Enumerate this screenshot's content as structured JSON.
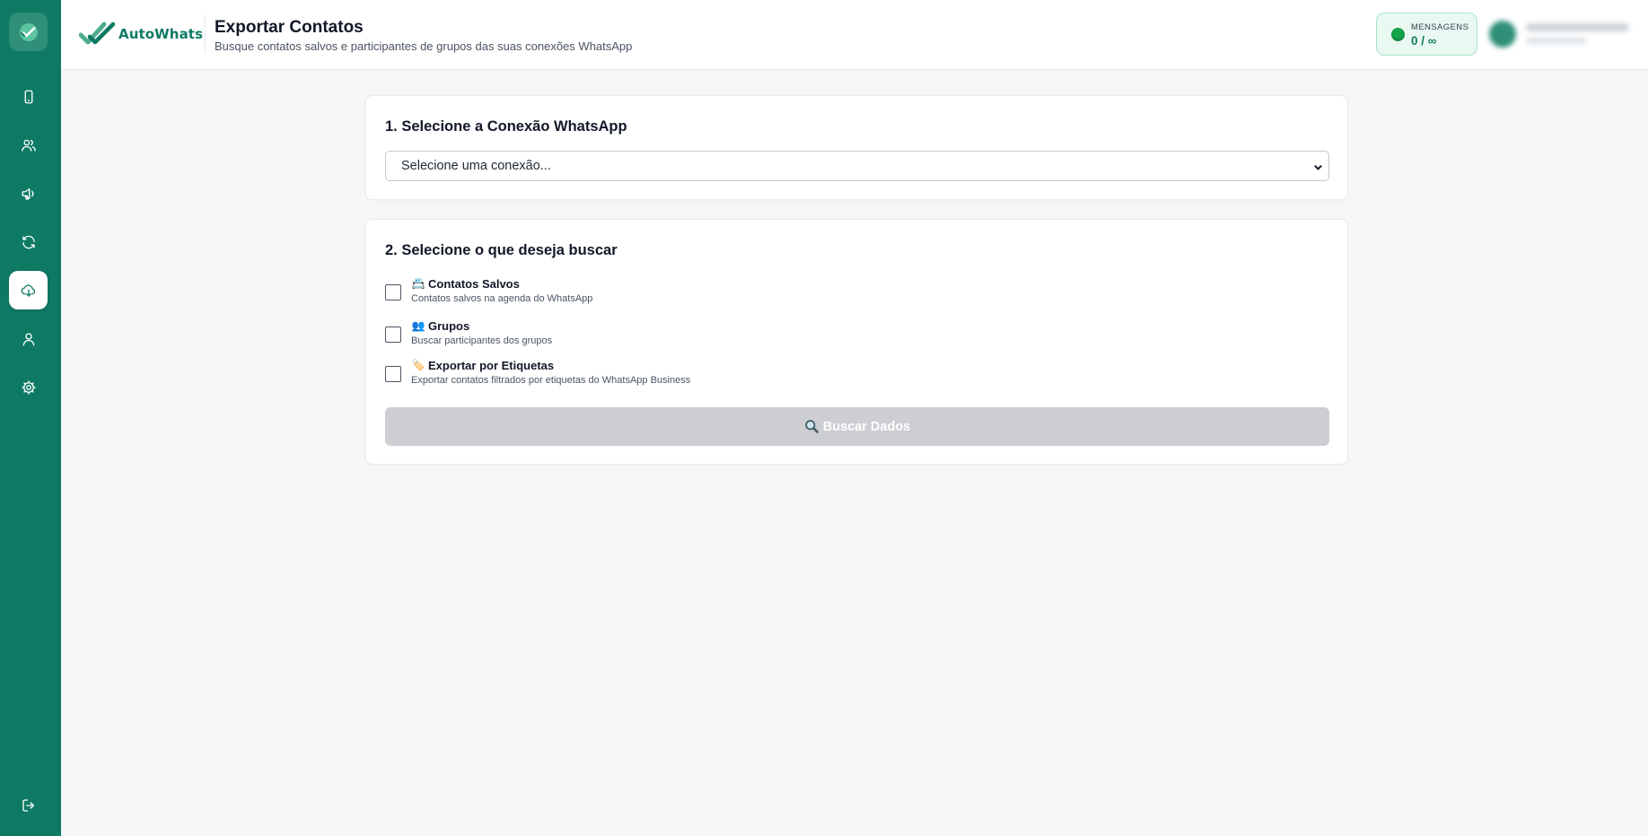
{
  "app": {
    "name": "AutoWhats"
  },
  "header": {
    "title": "Exportar Contatos",
    "subtitle": "Busque contatos salvos e participantes de grupos das suas conexões WhatsApp"
  },
  "messages_badge": {
    "label": "MENSAGENS",
    "count": "0 / ∞",
    "status_color": "#16a34a"
  },
  "sidebar": {
    "items": [
      {
        "name": "connections",
        "icon": "smartphone-icon"
      },
      {
        "name": "contacts",
        "icon": "users-icon"
      },
      {
        "name": "campaigns",
        "icon": "megaphone-icon"
      },
      {
        "name": "sync",
        "icon": "refresh-icon"
      },
      {
        "name": "export",
        "icon": "cloud-download-icon",
        "active": true
      },
      {
        "name": "profile",
        "icon": "user-icon"
      },
      {
        "name": "settings",
        "icon": "gear-icon"
      },
      {
        "name": "logout",
        "icon": "logout-icon"
      }
    ]
  },
  "step1": {
    "title": "1. Selecione a Conexão WhatsApp",
    "select_value": "Selecione uma conexão..."
  },
  "step2": {
    "title": "2. Selecione o que deseja buscar",
    "options": [
      {
        "emoji": "📇",
        "label": "Contatos Salvos",
        "description": "Contatos salvos na agenda do WhatsApp",
        "checked": false
      },
      {
        "emoji": "👥",
        "label": "Grupos",
        "description": "Buscar participantes dos grupos",
        "checked": false
      },
      {
        "emoji": "🏷️",
        "label": "Exportar por Etiquetas",
        "description": "Exportar contatos filtrados por etiquetas do WhatsApp Business",
        "checked": false
      }
    ],
    "search_button": "Buscar Dados"
  },
  "colors": {
    "primary": "#0e7a64",
    "background": "#f4f6f8",
    "button_disabled": "#ccced2"
  }
}
